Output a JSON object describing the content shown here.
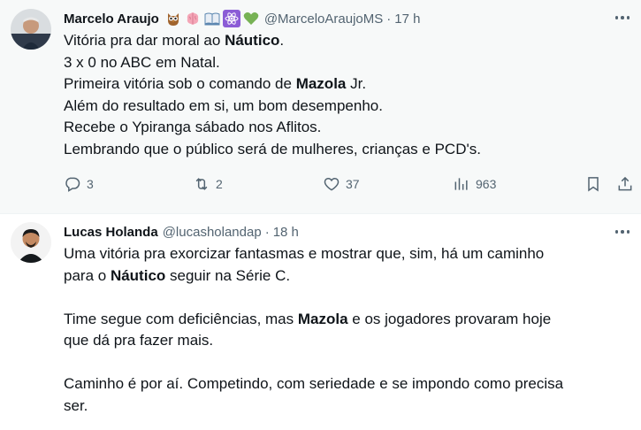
{
  "tweets": [
    {
      "name": "Marcelo Araujo",
      "emojis": [
        "owl-emoji",
        "brain-emoji",
        "open-book-emoji",
        "atom-emoji",
        "green-heart-emoji"
      ],
      "handle": "@MarceloAraujoMS",
      "separator": "·",
      "time": "17 h",
      "lines": [
        [
          "Vitória pra dar moral ao ",
          {
            "b": "Náutico"
          },
          "."
        ],
        [
          "3 x 0 no ABC em Natal."
        ],
        [
          "Primeira vitória sob o comando de ",
          {
            "b": "Mazola"
          },
          " Jr."
        ],
        [
          "Além do resultado em si, um bom desempenho."
        ],
        [
          "Recebe o Ypiranga sábado nos Aflitos."
        ],
        [
          "Lembrando que o público será de mulheres, crianças e PCD's."
        ]
      ],
      "stats": {
        "replies": "3",
        "reposts": "2",
        "likes": "37",
        "views": "963"
      }
    },
    {
      "name": "Lucas Holanda",
      "handle": "@lucasholandap",
      "separator": "·",
      "time": "18 h",
      "lines": [
        [
          "Uma vitória pra exorcizar fantasmas e mostrar que, sim, há um caminho"
        ],
        [
          "para o ",
          {
            "b": "Náutico"
          },
          " seguir na Série C."
        ],
        [],
        [
          "Time segue com deficiências, mas ",
          {
            "b": "Mazola"
          },
          " e os jogadores provaram hoje"
        ],
        [
          "que dá pra fazer mais."
        ],
        [],
        [
          "Caminho é por aí. Competindo, com seriedade e se impondo como precisa"
        ],
        [
          "ser."
        ]
      ]
    }
  ],
  "icons": {
    "reply": "reply-icon",
    "repost": "repost-icon",
    "like": "like-icon",
    "views": "views-icon",
    "bookmark": "bookmark-icon",
    "share": "share-icon",
    "more": "more-icon"
  },
  "colors": {
    "text": "#0f1419",
    "secondary": "#536471",
    "highlight_bg": "#f7f9f9",
    "divider": "#eff3f4"
  }
}
